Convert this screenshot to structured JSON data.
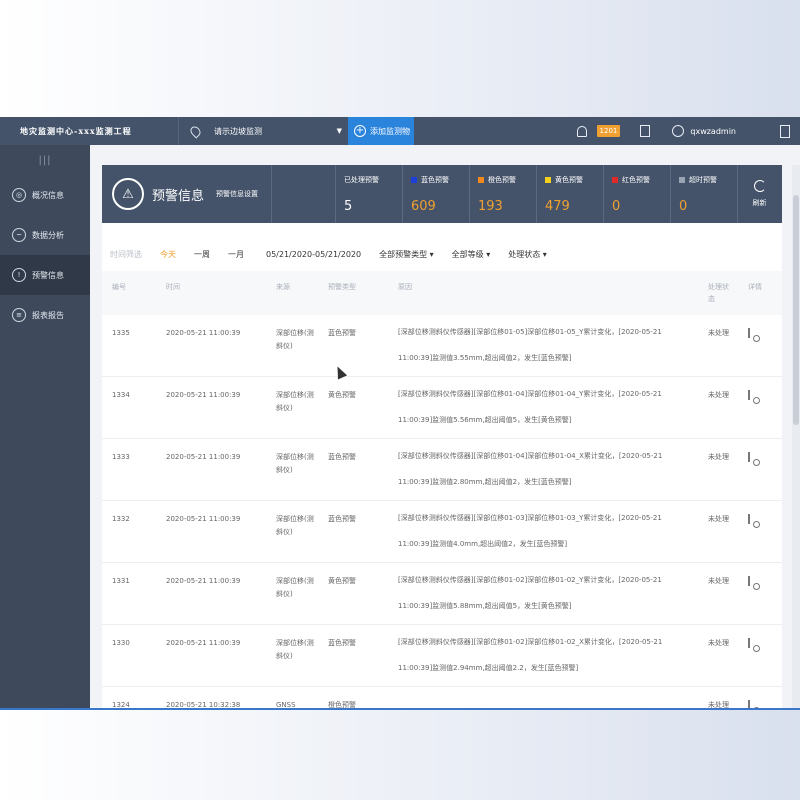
{
  "topbar": {
    "app_title": "地灾监测中心-xxx监测工程",
    "location": "请示边坡监测",
    "add_label": "添加监测物",
    "notification_count": "1201",
    "username": "qxwzadmin"
  },
  "sidebar": {
    "items": [
      {
        "label": "概况信息",
        "icon": "overview-icon"
      },
      {
        "label": "数据分析",
        "icon": "chart-icon"
      },
      {
        "label": "预警信息",
        "icon": "warning-icon"
      },
      {
        "label": "报表报告",
        "icon": "report-icon"
      }
    ]
  },
  "header": {
    "title": "预警信息",
    "setting": "预警信息设置",
    "stats": [
      {
        "label": "已处理预警",
        "value": "5",
        "color": ""
      },
      {
        "label": "蓝色预警",
        "value": "609",
        "color": "#1e3fd8"
      },
      {
        "label": "橙色预警",
        "value": "193",
        "color": "#f08a1c"
      },
      {
        "label": "黄色预警",
        "value": "479",
        "color": "#f2d21a"
      },
      {
        "label": "红色预警",
        "value": "0",
        "color": "#e02a2a"
      },
      {
        "label": "超时预警",
        "value": "0",
        "color": "#9aa3b1"
      }
    ],
    "refresh": "刷新"
  },
  "filters": {
    "label": "时间筛选",
    "tabs": [
      "今天",
      "一周",
      "一月"
    ],
    "date_range": "05/21/2020-05/21/2020",
    "dropdowns": [
      "全部预警类型",
      "全部等级",
      "处理状态"
    ]
  },
  "table": {
    "headers": {
      "id": "编号",
      "time": "时间",
      "source": "来源",
      "type": "预警类型",
      "reason": "原因",
      "status": "处理状态",
      "action": "详情"
    },
    "rows": [
      {
        "id": "1335",
        "time": "2020-05-21 11:00:39",
        "source": "深部位移(测斜仪)",
        "type": "蓝色预警",
        "reason": "[深部位移测斜仪传感器][深部位移01-05]深部位移01-05_Y累计变化，[2020-05-21 11:00:39]监测值3.55mm,超出阈值2，发生[蓝色预警]",
        "status": "未处理"
      },
      {
        "id": "1334",
        "time": "2020-05-21 11:00:39",
        "source": "深部位移(测斜仪)",
        "type": "黄色预警",
        "reason": "[深部位移测斜仪传感器][深部位移01-04]深部位移01-04_Y累计变化，[2020-05-21 11:00:39]监测值5.56mm,超出阈值5，发生[黄色预警]",
        "status": "未处理"
      },
      {
        "id": "1333",
        "time": "2020-05-21 11:00:39",
        "source": "深部位移(测斜仪)",
        "type": "蓝色预警",
        "reason": "[深部位移测斜仪传感器][深部位移01-04]深部位移01-04_X累计变化，[2020-05-21 11:00:39]监测值2.80mm,超出阈值2，发生[蓝色预警]",
        "status": "未处理"
      },
      {
        "id": "1332",
        "time": "2020-05-21 11:00:39",
        "source": "深部位移(测斜仪)",
        "type": "蓝色预警",
        "reason": "[深部位移测斜仪传感器][深部位移01-03]深部位移01-03_Y累计变化，[2020-05-21 11:00:39]监测值4.0mm,超出阈值2，发生[蓝色预警]",
        "status": "未处理"
      },
      {
        "id": "1331",
        "time": "2020-05-21 11:00:39",
        "source": "深部位移(测斜仪)",
        "type": "黄色预警",
        "reason": "[深部位移测斜仪传感器][深部位移01-02]深部位移01-02_Y累计变化，[2020-05-21 11:00:39]监测值5.88mm,超出阈值5，发生[黄色预警]",
        "status": "未处理"
      },
      {
        "id": "1330",
        "time": "2020-05-21 11:00:39",
        "source": "深部位移(测斜仪)",
        "type": "蓝色预警",
        "reason": "[深部位移测斜仪传感器][深部位移01-02]深部位移01-02_X累计变化，[2020-05-21 11:00:39]监测值2.94mm,超出阈值2.2，发生[蓝色预警]",
        "status": "未处理"
      },
      {
        "id": "1324",
        "time": "2020-05-21 10:32:38",
        "source": "GNSS",
        "type": "橙色预警",
        "reason": "",
        "status": "未处理"
      }
    ]
  }
}
